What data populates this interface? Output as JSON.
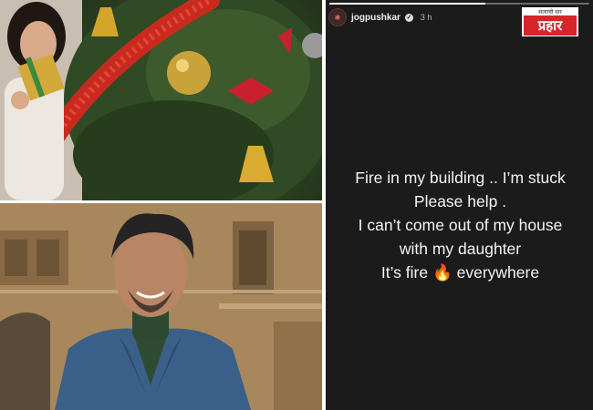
{
  "story": {
    "username": "jogpushkar",
    "verified_icon": "verified-badge-icon",
    "time": "3 h",
    "progress": 0.6,
    "lines": [
      "Fire in my building .. I’m stuck",
      "Please help .",
      "I can’t come out of my house",
      "with my daughter",
      "It’s fire 🔥 everywhere"
    ]
  },
  "logo": {
    "tagline": "सत्याची धार",
    "name": "प्रहार",
    "color": "#d6262a"
  },
  "photos": {
    "top_alt": "girl-with-christmas-tree",
    "bottom_alt": "man-smiling-portrait"
  }
}
